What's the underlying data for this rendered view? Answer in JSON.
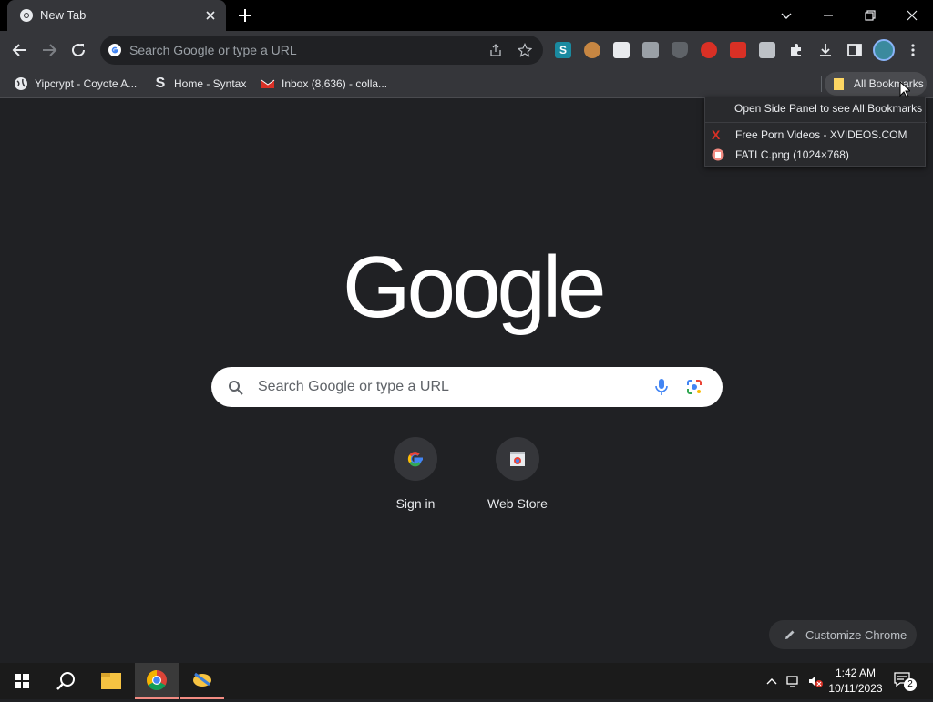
{
  "tab": {
    "title": "New Tab"
  },
  "omnibox": {
    "placeholder": "Search Google or type a URL"
  },
  "bookmarks_bar": {
    "items": [
      {
        "label": "Yipcrypt - Coyote A...",
        "icon": "globe-icon"
      },
      {
        "label": "Home - Syntax",
        "icon": "syntax-s-icon"
      },
      {
        "label": "Inbox (8,636) - colla...",
        "icon": "gmail-icon"
      }
    ],
    "all_bookmarks_label": "All Bookmarks"
  },
  "bookmarks_menu": {
    "header": "Open Side Panel to see All Bookmarks",
    "items": [
      {
        "label": "Free Porn Videos - XVIDEOS.COM",
        "icon": "xvideos-icon"
      },
      {
        "label": "FATLC.png (1024×768)",
        "icon": "image-file-icon"
      }
    ]
  },
  "ntp": {
    "logo_text": "Google",
    "search_placeholder": "Search Google or type a URL",
    "shortcuts": [
      {
        "label": "Sign in",
        "icon": "google-g-icon"
      },
      {
        "label": "Web Store",
        "icon": "webstore-icon"
      }
    ],
    "customize_label": "Customize Chrome"
  },
  "taskbar": {
    "time": "1:42 AM",
    "date": "10/11/2023",
    "notification_count": "2"
  },
  "colors": {
    "accent": "#8ab4f8",
    "toolbar": "#35363a",
    "page_bg": "#202124",
    "taskbar_bg": "#1b1b1b"
  }
}
